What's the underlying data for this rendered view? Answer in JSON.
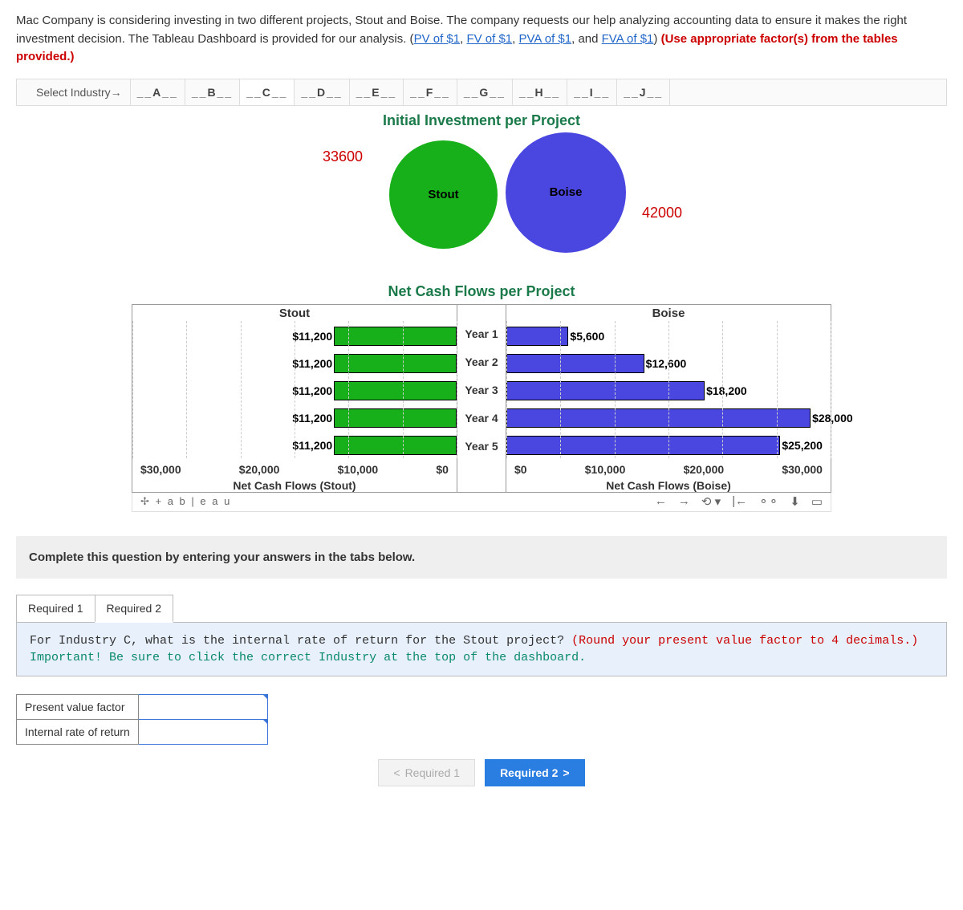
{
  "intro": {
    "text1": "Mac Company is considering investing in two different projects, Stout and Boise. The company requests our help analyzing accounting data to ensure it makes the right investment decision. The Tableau Dashboard is provided for our analysis. (",
    "link1": "PV of $1",
    "link2": "FV of $1",
    "link3": "PVA of $1",
    "and": ", and ",
    "link4": "FVA of $1",
    "close": ") ",
    "red": "(Use appropriate factor(s) from the tables provided.)"
  },
  "tabs": {
    "label": "Select Industry→",
    "items": [
      "__A__",
      "__B__",
      "__C__",
      "__D__",
      "__E__",
      "__F__",
      "__G__",
      "__H__",
      "__I__",
      "__J__"
    ]
  },
  "dashboard": {
    "title1": "Initial Investment per Project",
    "circle_stout": "Stout",
    "circle_boise": "Boise",
    "anno_stout": "33600",
    "anno_boise": "42000",
    "title2": "Net Cash Flows per Project",
    "col_stout": "Stout",
    "col_boise": "Boise",
    "years": [
      "Year 1",
      "Year 2",
      "Year 3",
      "Year 4",
      "Year 5"
    ],
    "stout_labels": [
      "$11,200",
      "$11,200",
      "$11,200",
      "$11,200",
      "$11,200"
    ],
    "boise_labels": [
      "$5,600",
      "$12,600",
      "$18,200",
      "$28,000",
      "$25,200"
    ],
    "stout_axis": [
      "$30,000",
      "$20,000",
      "$10,000",
      "$0"
    ],
    "boise_axis": [
      "$0",
      "$10,000",
      "$20,000",
      "$30,000"
    ],
    "stout_axis_title": "Net Cash Flows (Stout)",
    "boise_axis_title": "Net Cash Flows (Boise)",
    "tableau_text": "✢ + a b | e a u"
  },
  "instruction": "Complete this question by entering your answers in the tabs below.",
  "req_tabs": {
    "r1": "Required 1",
    "r2": "Required 2"
  },
  "req_body": {
    "t1": "For Industry C, what is the internal rate of return for the Stout project? ",
    "red": "(Round your present value factor to 4 decimals.)",
    "teal": "Important! Be sure to click the correct Industry at the top of the dashboard."
  },
  "ans": {
    "r1": "Present value factor",
    "r2": "Internal rate of return"
  },
  "nav": {
    "prev": "Required 1",
    "next": "Required 2"
  },
  "chart_data": [
    {
      "type": "pie",
      "title": "Initial Investment per Project",
      "series": [
        {
          "name": "Stout",
          "values": [
            33600
          ]
        },
        {
          "name": "Boise",
          "values": [
            42000
          ]
        }
      ]
    },
    {
      "type": "bar",
      "title": "Net Cash Flows per Project",
      "categories": [
        "Year 1",
        "Year 2",
        "Year 3",
        "Year 4",
        "Year 5"
      ],
      "series": [
        {
          "name": "Stout",
          "values": [
            11200,
            11200,
            11200,
            11200,
            11200
          ]
        },
        {
          "name": "Boise",
          "values": [
            5600,
            12600,
            18200,
            28000,
            25200
          ]
        }
      ],
      "xlabel_left": "Net Cash Flows (Stout)",
      "xlabel_right": "Net Cash Flows (Boise)",
      "xlim_left": [
        0,
        30000
      ],
      "xlim_right": [
        0,
        30000
      ]
    }
  ]
}
